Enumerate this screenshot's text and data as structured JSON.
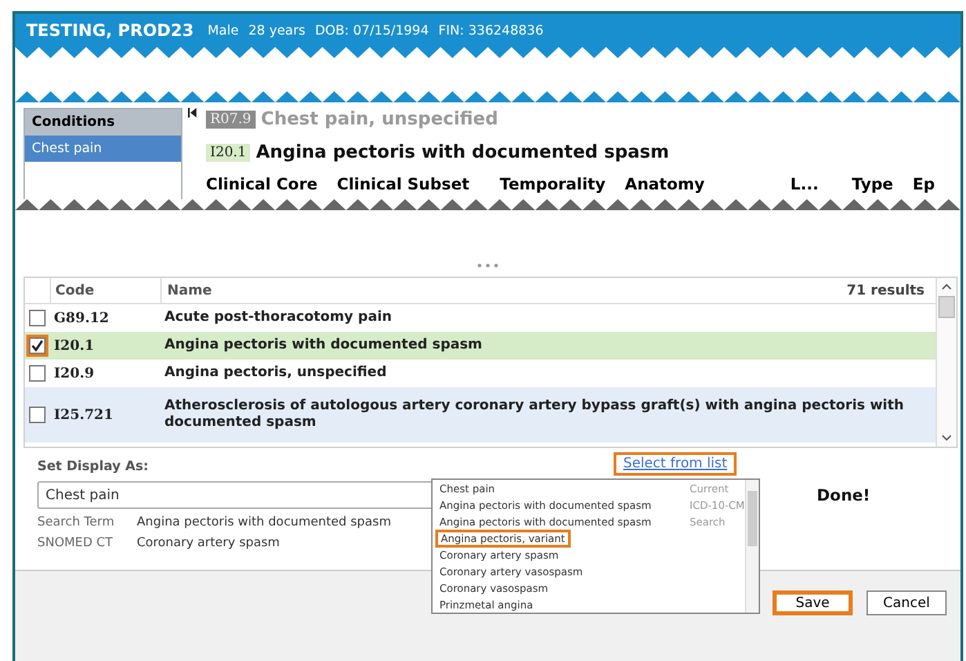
{
  "header": {
    "patient_name": "TESTING, PROD23",
    "sex": "Male",
    "age": "28 years",
    "dob": "DOB: 07/15/1994",
    "fin": "FIN: 336248836"
  },
  "conditions_panel": {
    "title": "Conditions",
    "items": [
      {
        "label": "Chest pain",
        "selected": true
      }
    ]
  },
  "current_condition": {
    "code": "R07.9",
    "name": "Chest pain, unspecified"
  },
  "new_condition": {
    "code": "I20.1",
    "name": "Angina pectoris with documented spasm"
  },
  "detail_tabs": [
    "Clinical Core",
    "Clinical Subset",
    "Temporality",
    "Anatomy",
    "L...",
    "Type",
    "Ep"
  ],
  "results": {
    "columns": [
      "Code",
      "Name"
    ],
    "count": "71 results",
    "rows": [
      {
        "code": "G89.12",
        "name": "Acute post-thoracotomy pain",
        "checked": false,
        "highlighted": false,
        "selected": false,
        "hovered": false
      },
      {
        "code": "I20.1",
        "name": "Angina pectoris with documented spasm",
        "checked": true,
        "highlighted": true,
        "selected": true,
        "hovered": false
      },
      {
        "code": "I20.9",
        "name": "Angina pectoris, unspecified",
        "checked": false,
        "highlighted": false,
        "selected": false,
        "hovered": false
      },
      {
        "code": "I25.721",
        "name": "Atherosclerosis of autologous artery coronary artery bypass graft(s) with angina pectoris with documented spasm",
        "checked": false,
        "highlighted": false,
        "selected": false,
        "hovered": true
      }
    ]
  },
  "display": {
    "label": "Set Display As:",
    "value": "Chest pain",
    "select_link": {
      "label": "Select from list",
      "highlighted": true
    },
    "search_term_label": "Search Term",
    "search_term": "Angina pectoris with documented spasm",
    "snomed_label": "SNOMED CT",
    "snomed": "Coronary artery spasm",
    "status": "Done!"
  },
  "dropdown": {
    "options": [
      {
        "label": "Chest pain",
        "source": "Current",
        "highlighted": false
      },
      {
        "label": "Angina pectoris with documented spasm",
        "source": "ICD-10-CM",
        "highlighted": false
      },
      {
        "label": "Angina pectoris with documented spasm",
        "source": "Search",
        "highlighted": false
      },
      {
        "label": "Angina pectoris, variant",
        "highlighted": true
      },
      {
        "label": "Coronary artery spasm",
        "highlighted": false
      },
      {
        "label": "Coronary artery vasospasm",
        "highlighted": false
      },
      {
        "label": "Coronary vasospasm",
        "highlighted": false
      },
      {
        "label": "Prinzmetal angina",
        "highlighted": false
      }
    ]
  },
  "buttons": [
    {
      "label": "Save",
      "highlighted": true
    },
    {
      "label": "Cancel",
      "highlighted": false
    }
  ]
}
